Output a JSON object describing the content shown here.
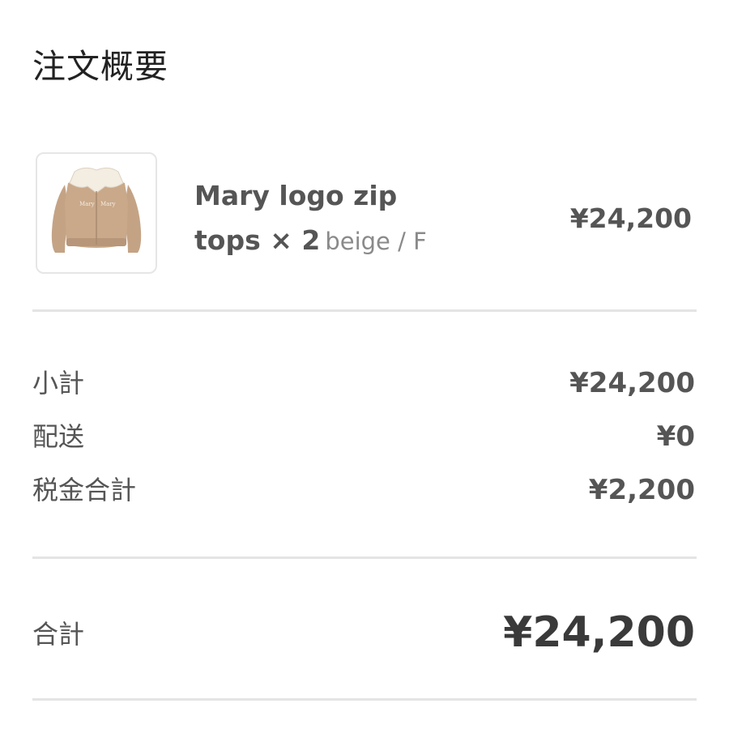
{
  "page": {
    "title": "注文概要"
  },
  "item": {
    "image_icon": "beige-zip-cardigan-thumbnail",
    "name_line1": "Mary logo zip",
    "name_line2": "tops × 2",
    "variant": "beige / F",
    "price": "¥24,200"
  },
  "summary": {
    "rows": [
      {
        "label": "小計",
        "value": "¥24,200"
      },
      {
        "label": "配送",
        "value": "¥0"
      },
      {
        "label": "税金合計",
        "value": "¥2,200"
      }
    ]
  },
  "total": {
    "label": "合計",
    "value": "¥24,200"
  },
  "colors": {
    "text": "#555555",
    "divider": "#e4e4e4",
    "variant_text": "#8a8a8a"
  }
}
